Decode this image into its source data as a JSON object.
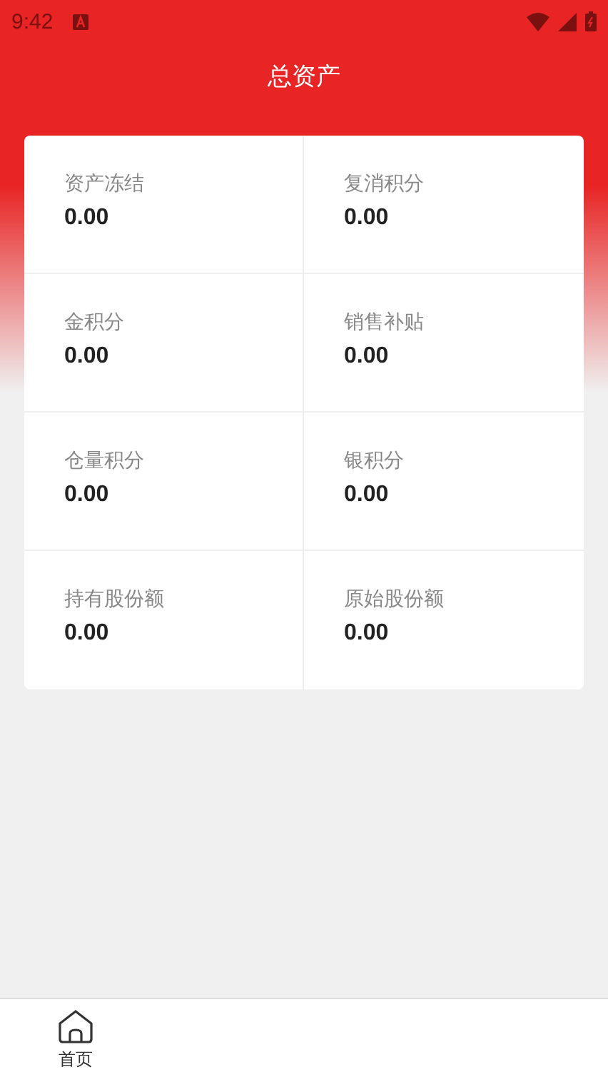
{
  "status_bar": {
    "time": "9:42"
  },
  "header": {
    "title": "总资产"
  },
  "assets": [
    {
      "label": "资产冻结",
      "value": "0.00"
    },
    {
      "label": "复消积分",
      "value": "0.00"
    },
    {
      "label": "金积分",
      "value": "0.00"
    },
    {
      "label": "销售补贴",
      "value": "0.00"
    },
    {
      "label": "仓量积分",
      "value": "0.00"
    },
    {
      "label": "银积分",
      "value": "0.00"
    },
    {
      "label": "持有股份额",
      "value": "0.00"
    },
    {
      "label": "原始股份额",
      "value": "0.00"
    }
  ],
  "tab_bar": [
    {
      "label": "首页",
      "selected": false
    }
  ]
}
